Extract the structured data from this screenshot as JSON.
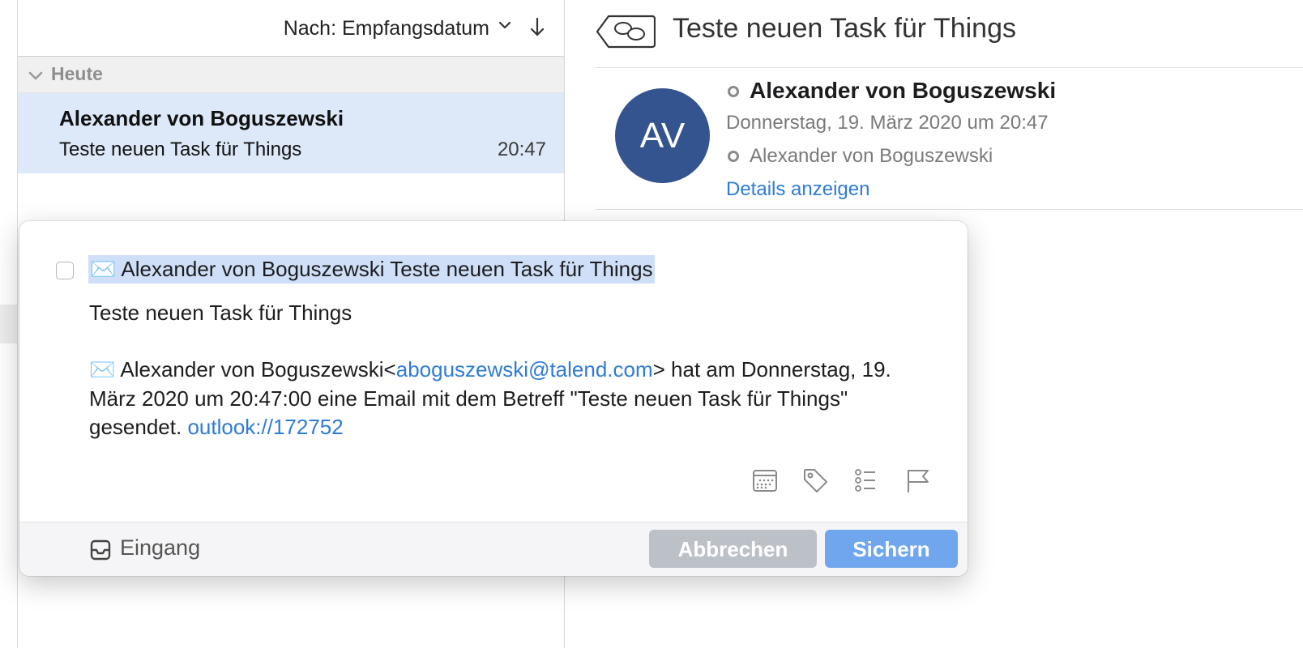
{
  "message_list": {
    "sort_label": "Nach: Empfangsdatum",
    "group_label": "Heute",
    "messages": [
      {
        "sender": "Alexander von Boguszewski",
        "subject": "Teste neuen Task für Things",
        "time": "20:47"
      }
    ]
  },
  "reading_pane": {
    "subject": "Teste neuen Task für Things",
    "avatar_initials": "AV",
    "avatar_color": "#34548f",
    "from_name": "Alexander von Boguszewski",
    "date": "Donnerstag, 19. März 2020 um 20:47",
    "to_name": "Alexander von Boguszewski",
    "details_link": "Details anzeigen"
  },
  "popup": {
    "title_emoji": "✉️",
    "title_text": "Alexander von Boguszewski Teste neuen Task für Things",
    "note_first_line": "Teste neuen Task für Things",
    "note_emoji": "✉️",
    "note_sender": "Alexander von Boguszewski<",
    "note_email": "aboguszewski@talend.com",
    "note_middle": "> hat am Donnerstag, 19. März 2020 um 20:47:00 eine Email mit dem Betreff \"Teste neuen Task für Things\" gesendet. ",
    "note_link": "outlook://172752",
    "footer": {
      "list_label": "Eingang",
      "cancel_label": "Abbrechen",
      "save_label": "Sichern"
    },
    "icons": [
      "calendar-icon",
      "tag-icon",
      "checklist-icon",
      "flag-icon"
    ]
  },
  "colors": {
    "accent_link": "#2f7bd6",
    "selection_bg": "#dde9f8",
    "save_button": "#6fa6ee",
    "cancel_button": "#bcc0c7"
  }
}
